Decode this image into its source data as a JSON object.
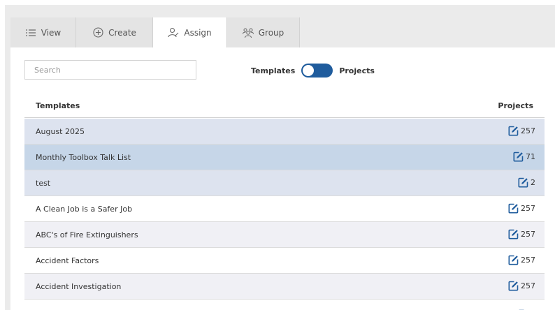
{
  "tabs": [
    {
      "label": "View",
      "icon": "list-icon"
    },
    {
      "label": "Create",
      "icon": "plus-circle-icon"
    },
    {
      "label": "Assign",
      "icon": "user-assign-icon"
    },
    {
      "label": "Group",
      "icon": "group-icon"
    }
  ],
  "active_tab": "Assign",
  "search": {
    "placeholder": "Search",
    "value": ""
  },
  "toggle": {
    "left_label": "Templates",
    "right_label": "Projects",
    "state": "Projects"
  },
  "table": {
    "columns": [
      "Templates",
      "Projects"
    ],
    "rows": [
      {
        "name": "August 2025",
        "count": "257",
        "style": "highlighted"
      },
      {
        "name": "Monthly Toolbox Talk List",
        "count": "71",
        "style": "selected"
      },
      {
        "name": "test",
        "count": "2",
        "style": "highlighted"
      },
      {
        "name": "A Clean Job is a Safer Job",
        "count": "257",
        "style": "plain"
      },
      {
        "name": "ABC's of Fire Extinguishers",
        "count": "257",
        "style": "alt"
      },
      {
        "name": "Accident Factors",
        "count": "257",
        "style": "plain"
      },
      {
        "name": "Accident Investigation",
        "count": "257",
        "style": "alt"
      }
    ]
  },
  "colors": {
    "accent": "#1f5c9d",
    "edit_icon": "#1f5c9d",
    "row_highlight": "#dde3ef",
    "row_selected": "#c6d6e8",
    "row_alt": "#f0f0f5",
    "tab_inactive": "#e4e4e4",
    "frame": "#ebebeb"
  }
}
